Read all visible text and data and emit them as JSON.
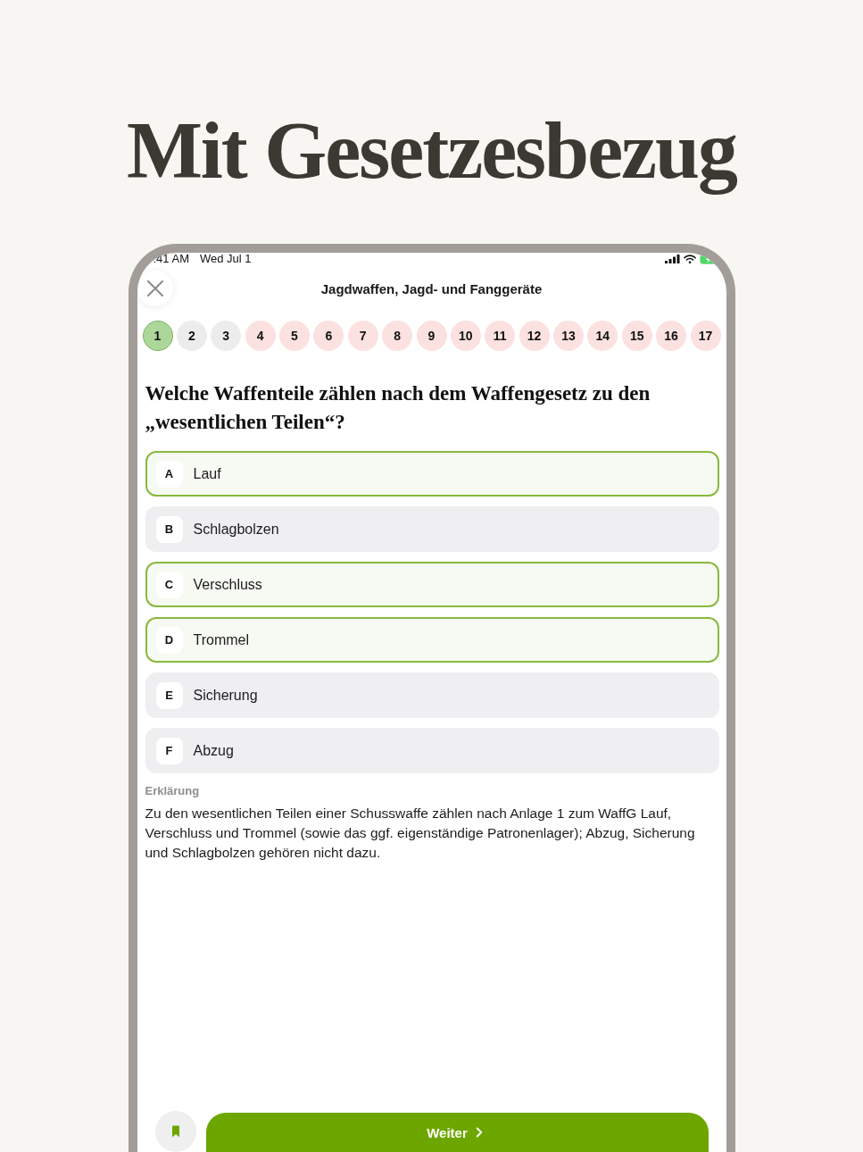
{
  "headline": "Mit Gesetzesbezug",
  "status_bar": {
    "time": ":41 AM",
    "date": "Wed Jul 1"
  },
  "header": {
    "title": "Jagdwaffen, Jagd- und Fanggeräte"
  },
  "question_nav": [
    {
      "label": "1",
      "selected": true,
      "color": "#acd69a"
    },
    {
      "label": "2",
      "selected": false,
      "color": "#ececec"
    },
    {
      "label": "3",
      "selected": false,
      "color": "#ececec"
    },
    {
      "label": "4",
      "selected": false,
      "color": "#fbe1df"
    },
    {
      "label": "5",
      "selected": false,
      "color": "#fbe1df"
    },
    {
      "label": "6",
      "selected": false,
      "color": "#fbe1df"
    },
    {
      "label": "7",
      "selected": false,
      "color": "#fbe1df"
    },
    {
      "label": "8",
      "selected": false,
      "color": "#fbe1df"
    },
    {
      "label": "9",
      "selected": false,
      "color": "#fbe1df"
    },
    {
      "label": "10",
      "selected": false,
      "color": "#fbe1df"
    },
    {
      "label": "11",
      "selected": false,
      "color": "#fbe1df"
    },
    {
      "label": "12",
      "selected": false,
      "color": "#fbe1df"
    },
    {
      "label": "13",
      "selected": false,
      "color": "#fbe1df"
    },
    {
      "label": "14",
      "selected": false,
      "color": "#fbe1df"
    },
    {
      "label": "15",
      "selected": false,
      "color": "#fbe1df"
    },
    {
      "label": "16",
      "selected": false,
      "color": "#fbe1df"
    },
    {
      "label": "17",
      "selected": false,
      "color": "#fbe1df"
    }
  ],
  "question": {
    "text": "Welche Waffenteile zählen nach dem Waffengesetz zu den „wesentlichen Teilen“?"
  },
  "answers": [
    {
      "letter": "A",
      "text": "Lauf",
      "selected": true
    },
    {
      "letter": "B",
      "text": "Schlagbolzen",
      "selected": false
    },
    {
      "letter": "C",
      "text": "Verschluss",
      "selected": true
    },
    {
      "letter": "D",
      "text": "Trommel",
      "selected": true
    },
    {
      "letter": "E",
      "text": "Sicherung",
      "selected": false
    },
    {
      "letter": "F",
      "text": "Abzug",
      "selected": false
    }
  ],
  "explanation": {
    "label": "Erklärung",
    "text": "Zu den wesentlichen Teilen einer Schusswaffe zählen nach Anlage 1 zum WaffG Lauf, Verschluss und Trommel (sowie das ggf. eigenständige Patronenlager); Abzug, Sicherung und Schlagbolzen gehören nicht dazu."
  },
  "footer": {
    "next_button": "Weiter"
  }
}
